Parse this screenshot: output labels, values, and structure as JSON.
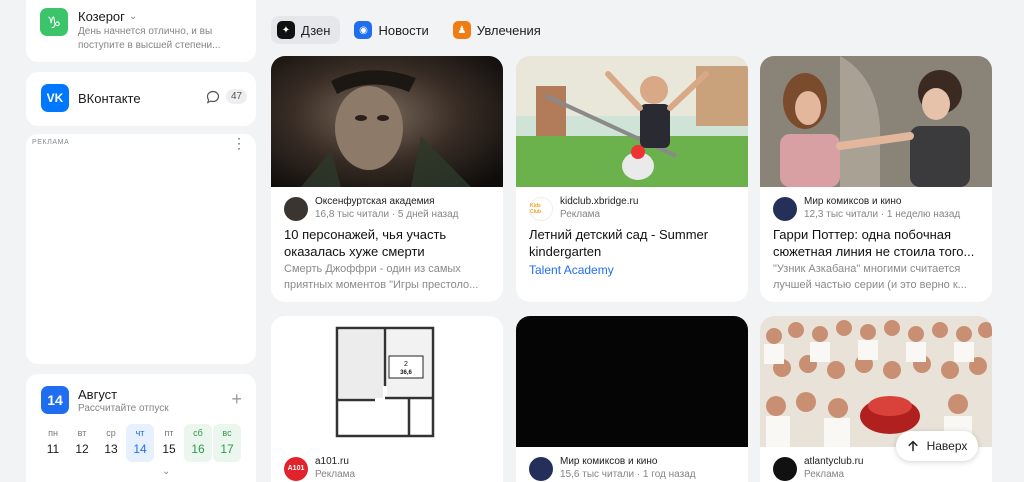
{
  "horoscope": {
    "icon": "capricorn-icon",
    "title": "Козерог",
    "text": "День начнется отлично, и вы поступите в высшей степени..."
  },
  "vk": {
    "icon_text": "VK",
    "title": "ВКонтакте",
    "messages_count": "47"
  },
  "ad": {
    "label": "РЕКЛАМА",
    "dots": "⋮"
  },
  "calendar": {
    "day": "14",
    "month": "Август",
    "subtitle": "Рассчитайте отпуск",
    "plus": "+",
    "days": [
      {
        "name": "пн",
        "num": "11"
      },
      {
        "name": "вт",
        "num": "12"
      },
      {
        "name": "ср",
        "num": "13"
      },
      {
        "name": "чт",
        "num": "14"
      },
      {
        "name": "пт",
        "num": "15"
      },
      {
        "name": "сб",
        "num": "16"
      },
      {
        "name": "вс",
        "num": "17"
      }
    ],
    "more": "⌄"
  },
  "tabs": [
    {
      "label": "Дзен",
      "icon": "zen-icon",
      "color": "#111111"
    },
    {
      "label": "Новости",
      "icon": "news-icon",
      "color": "#1f6ef0"
    },
    {
      "label": "Увлечения",
      "icon": "hobbies-icon",
      "color": "#f07c14"
    }
  ],
  "feed": [
    {
      "source": "Оксенфуртская академия",
      "meta": "16,8 тыс читали · 5 дней назад",
      "title": "10 персонажей, чья участь оказалась хуже смерти",
      "snippet": "Смерть Джоффри - один из самых приятных моментов \"Игры престоло..."
    },
    {
      "source": "kidclub.xbridge.ru",
      "meta": "Реклама",
      "logo_text": "Kids Club",
      "title": "Летний детский сад - Summer kindergarten",
      "link": "Talent Academy"
    },
    {
      "source": "Мир комиксов и кино",
      "meta": "12,3 тыс читали · 1 неделю назад",
      "title": "Гарри Поттер: одна побочная сюжетная линия не стоила того...",
      "snippet": "\"Узник Азкабана\" многими считается лучшей частью серии (и это верно к..."
    },
    {
      "source": "a101.ru",
      "meta": "Реклама",
      "logo_text": "A101",
      "plan_label": "2",
      "plan_area": "36,6"
    },
    {
      "source": "Мир комиксов и кино",
      "meta": "15,6 тыс читали · 1 год назад"
    },
    {
      "source": "atlantyclub.ru",
      "meta": "Реклама"
    }
  ],
  "scroll_up": {
    "label": "Наверх",
    "icon": "arrow-up-icon"
  }
}
